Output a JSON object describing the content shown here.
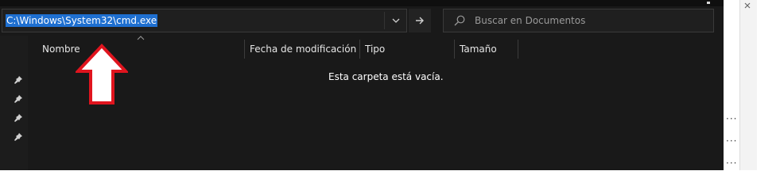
{
  "address_bar": {
    "path": "C:\\Windows\\System32\\cmd.exe",
    "dropdown_icon": "chevron-down-icon",
    "go_icon": "arrow-right-icon"
  },
  "search": {
    "placeholder": "Buscar en Documentos",
    "icon": "search-icon"
  },
  "columns": [
    {
      "label": "Nombre"
    },
    {
      "label": "Fecha de modificación"
    },
    {
      "label": "Tipo"
    },
    {
      "label": "Tamaño"
    }
  ],
  "empty_message": "Esta carpeta está vacía.",
  "nav_pane": {
    "pinned_icons": [
      "pin-icon",
      "pin-icon",
      "pin-icon",
      "pin-icon"
    ]
  },
  "annotation": {
    "type": "arrow-up",
    "fill_color": "#ffffff",
    "stroke_color": "#e0141e"
  },
  "colors": {
    "background": "#191919",
    "selection": "#1e6fd0",
    "text": "#ffffff"
  }
}
